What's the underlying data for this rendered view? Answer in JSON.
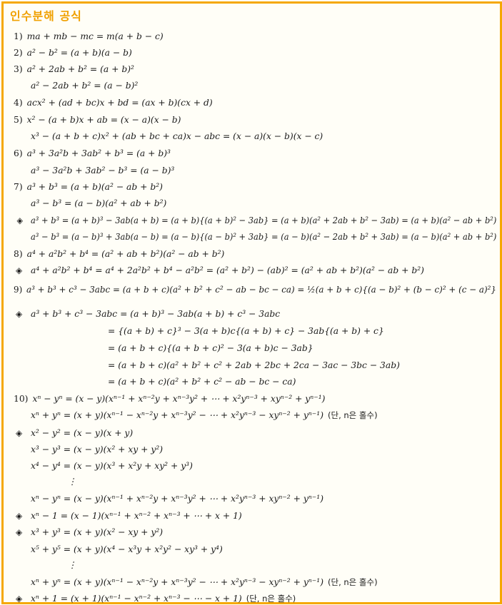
{
  "title": "인수분해 공식",
  "lines": [
    {
      "num": "1)",
      "text": "ma + mb − mc = m(a + b − c)"
    },
    {
      "num": "2)",
      "text": "a² − b² = (a + b)(a − b)"
    },
    {
      "num": "3)",
      "text": "a² + 2ab + b² = (a + b)²"
    },
    {
      "num": "",
      "text": "a² − 2ab + b² = (a − b)²"
    },
    {
      "num": "4)",
      "text": "acx² + (ad + bc)x + bd = (ax + b)(cx + d)"
    },
    {
      "num": "5)",
      "text": "x² − (a + b)x + ab = (x − a)(x − b)"
    },
    {
      "num": "",
      "text": "x³ − (a + b + c)x² + (ab + bc + ca)x − abc = (x − a)(x − b)(x − c)"
    },
    {
      "num": "6)",
      "text": "a³ + 3a²b + 3ab² + b³ = (a + b)³"
    },
    {
      "num": "",
      "text": "a³ − 3a²b + 3ab² − b³ = (a − b)³"
    },
    {
      "num": "7)",
      "text": "a³ + b³ = (a + b)(a² − ab + b²)"
    },
    {
      "num": "",
      "text": "a³ − b³ = (a − b)(a² + ab + b²)"
    },
    {
      "num": "◈",
      "text": "a³ + b³ = (a + b)³ − 3ab(a + b) = (a + b){(a + b)² − 3ab} = (a + b)(a² + 2ab + b² − 3ab) = (a + b)(a² − ab + b²)"
    },
    {
      "num": "",
      "text": "a³ − b³ = (a − b)³ + 3ab(a − b) = (a − b){(a − b)² + 3ab} = (a − b)(a² − 2ab + b² + 3ab) = (a − b)(a² + ab + b²)"
    },
    {
      "num": "8)",
      "text": "a⁴ + a²b² + b⁴ = (a² + ab + b²)(a² − ab + b²)"
    },
    {
      "num": "◈",
      "text": "a⁴ + a²b² + b⁴ = a⁴ + 2a²b² + b⁴ − a²b² = (a² + b²) − (ab)² = (a² + ab + b²)(a² − ab + b²)"
    },
    {
      "num": "9)",
      "text": "a³ + b³ + c³ − 3abc = (a + b + c)(a² + b² + c² − ab − bc − ca) = ½(a + b + c){(a − b)² + (b − c)² + (c − a)²}"
    },
    {
      "num": "◈",
      "text": "a³ + b³ + c³ − 3abc = (a + b)³ − 3ab(a + b) + c³ − 3abc"
    },
    {
      "num": "",
      "text": "= {(a + b) + c}³ − 3(a + b)c{(a + b) + c} − 3ab{(a + b) + c}"
    },
    {
      "num": "",
      "text": "= (a + b + c){(a + b + c)² − 3(a + b)c − 3ab}"
    },
    {
      "num": "",
      "text": "= (a + b + c)(a² + b² + c² + 2ab + 2bc + 2ca − 3ac − 3bc − 3ab)"
    },
    {
      "num": "",
      "text": "= (a + b + c)(a² + b² + c² − ab − bc − ca)"
    },
    {
      "num": "10)",
      "text": "xⁿ − yⁿ = (x − y)(xⁿ⁻¹ + xⁿ⁻²y + xⁿ⁻³y² + ⋯ + x²yⁿ⁻³ + xyⁿ⁻² + yⁿ⁻¹)"
    },
    {
      "num": "",
      "text": "xⁿ + yⁿ = (x + y)(xⁿ⁻¹ − xⁿ⁻²y + xⁿ⁻³y² − ⋯ + x²yⁿ⁻³ − xyⁿ⁻² + yⁿ⁻¹)",
      "note": "(단, n은 홀수)"
    },
    {
      "num": "◈",
      "text": "x² − y² = (x − y)(x + y)"
    },
    {
      "num": "",
      "text": "x³ − y³ = (x − y)(x² + xy + y²)"
    },
    {
      "num": "",
      "text": "x⁴ − y⁴ = (x − y)(x³ + x²y + xy² + y³)"
    },
    {
      "num": "",
      "text": "⋮"
    },
    {
      "num": "",
      "text": "xⁿ − yⁿ = (x − y)(xⁿ⁻¹ + xⁿ⁻²y + xⁿ⁻³y² + ⋯ + x²yⁿ⁻³ + xyⁿ⁻² + yⁿ⁻¹)"
    },
    {
      "num": "◈",
      "text": "xⁿ − 1 = (x − 1)(xⁿ⁻¹ + xⁿ⁻² + xⁿ⁻³ + ⋯ + x + 1)"
    },
    {
      "num": "◈",
      "text": "x³ + y³ = (x + y)(x² − xy + y²)"
    },
    {
      "num": "",
      "text": "x⁵ + y⁵ = (x + y)(x⁴ − x³y + x²y² − xy³ + y⁴)"
    },
    {
      "num": "",
      "text": "⋮"
    },
    {
      "num": "",
      "text": "xⁿ + yⁿ = (x + y)(xⁿ⁻¹ − xⁿ⁻²y + xⁿ⁻³y² − ⋯ + x²yⁿ⁻³ − xyⁿ⁻² + yⁿ⁻¹)",
      "note": "(단, n은 홀수)"
    },
    {
      "num": "◈",
      "text": "xⁿ + 1 = (x + 1)(xⁿ⁻¹ − xⁿ⁻² + xⁿ⁻³ − ⋯ − x + 1)",
      "note": "(단, n은 홀수)"
    }
  ]
}
